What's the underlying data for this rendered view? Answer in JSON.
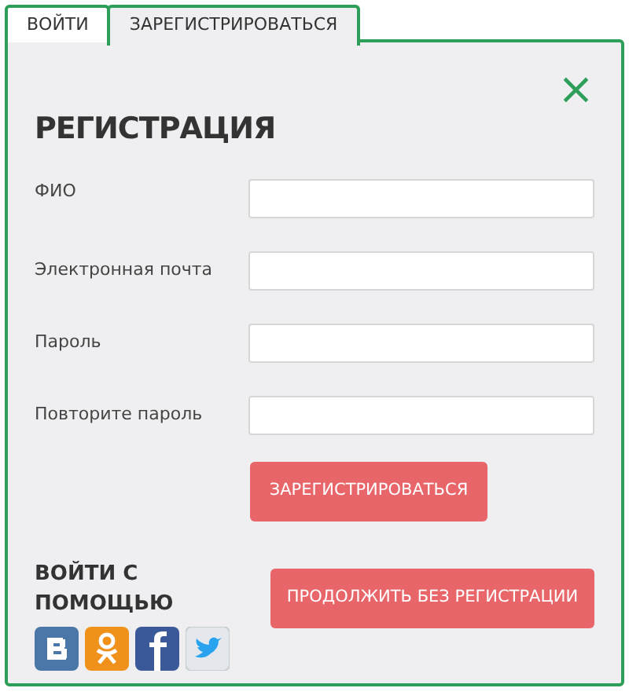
{
  "tabs": [
    {
      "label": "ВОЙТИ",
      "selected": false
    },
    {
      "label": "ЗАРЕГИСТРИРОВАТЬСЯ",
      "selected": true
    }
  ],
  "close": "×",
  "title": "РЕГИСТРАЦИЯ",
  "fields": [
    {
      "label": "ФИО"
    },
    {
      "label": "Электронная почта"
    },
    {
      "label": "Пароль"
    },
    {
      "label": "Повторите пароль"
    }
  ],
  "submit": "ЗАРЕГИСТРИРОВАТЬСЯ",
  "social": {
    "heading": "ВОЙТИ С ПОМОЩЬЮ",
    "networks": [
      {
        "kind": "vk"
      },
      {
        "kind": "ok"
      },
      {
        "kind": "facebook"
      },
      {
        "kind": "twitter"
      }
    ]
  },
  "skip": "ПРОДОЛЖИТЬ БЕЗ РЕГИСТРАЦИИ"
}
